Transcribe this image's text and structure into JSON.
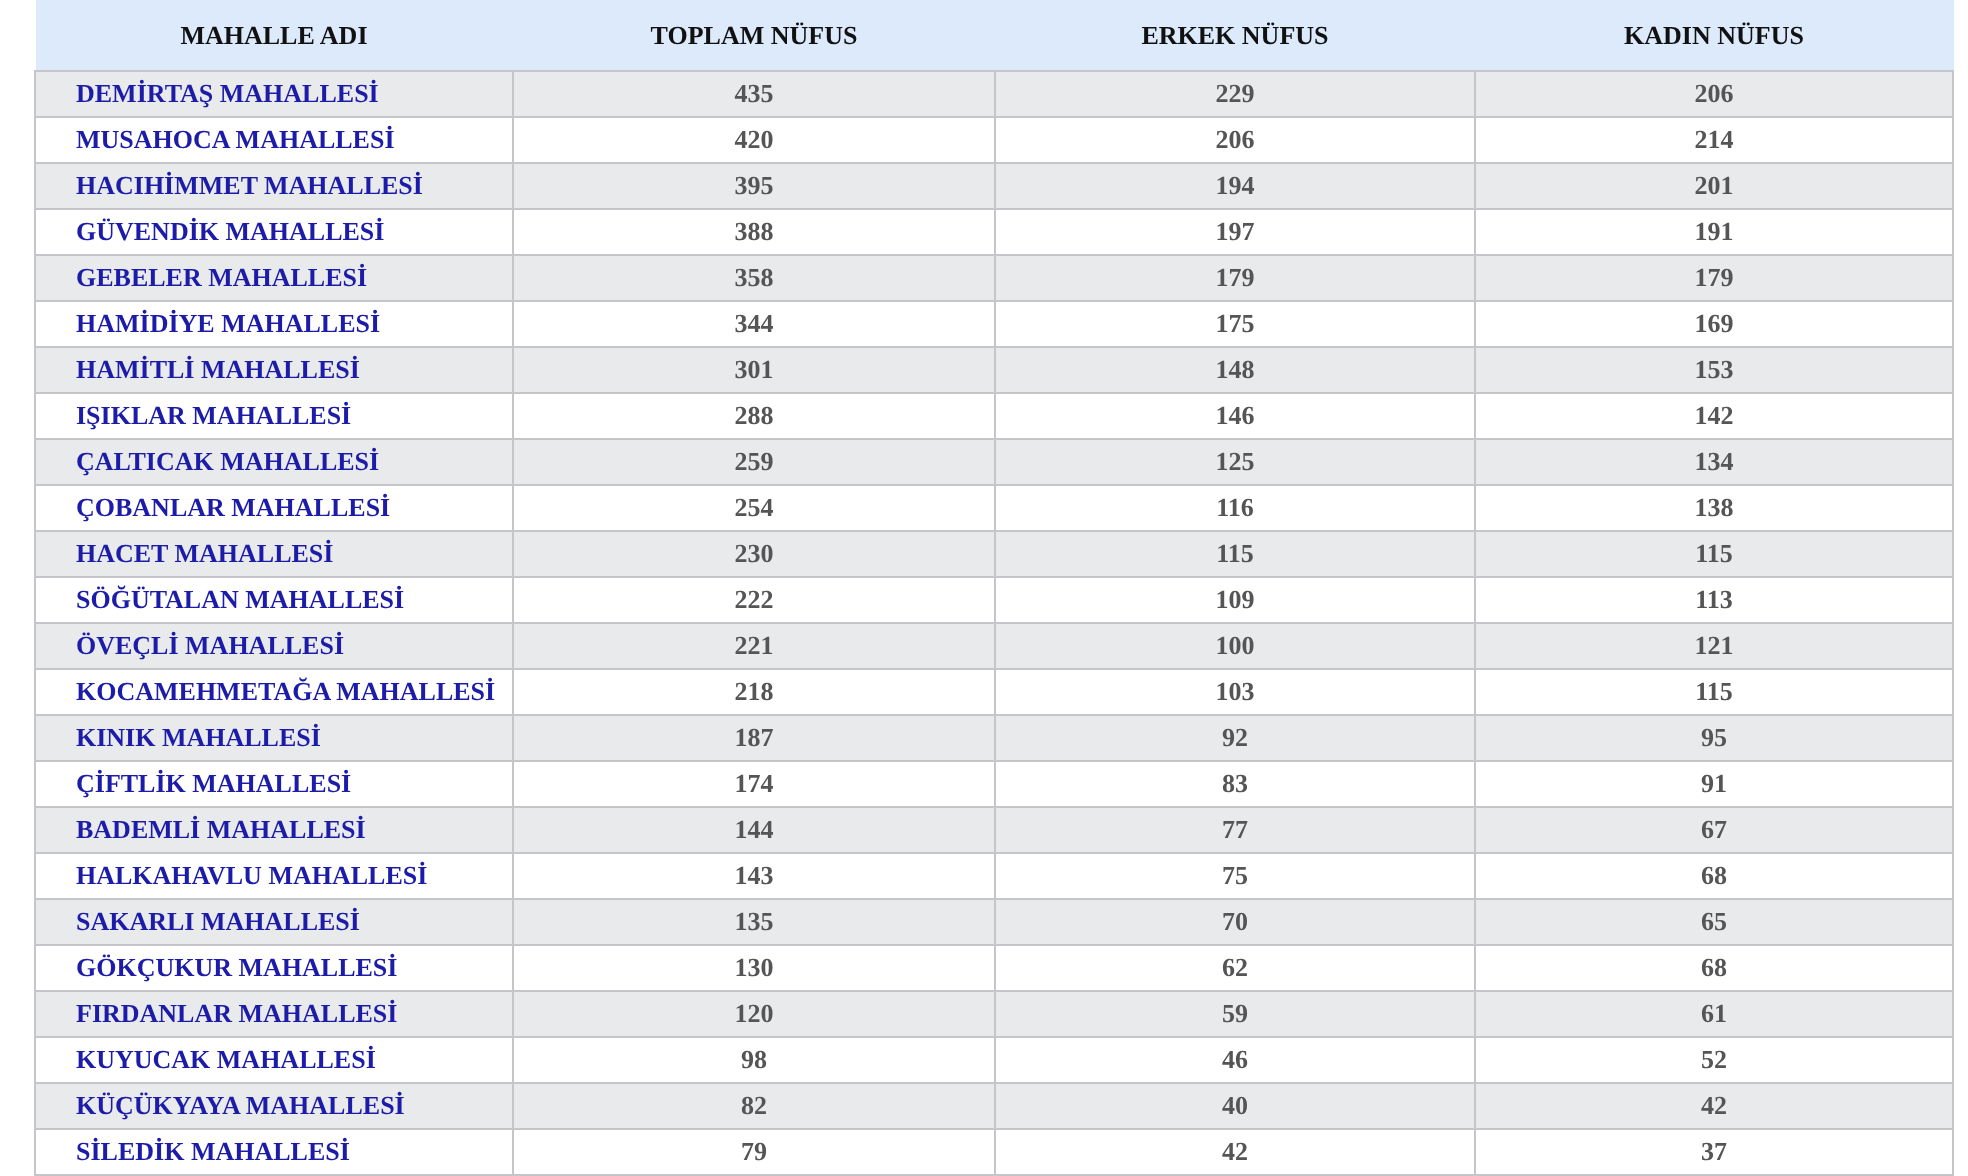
{
  "table": {
    "columns": [
      "MAHALLE ADI",
      "TOPLAM NÜFUS",
      "ERKEK NÜFUS",
      "KADIN NÜFUS"
    ],
    "rows": [
      [
        "DEMİRTAŞ MAHALLESİ",
        "435",
        "229",
        "206"
      ],
      [
        "MUSAHOCA MAHALLESİ",
        "420",
        "206",
        "214"
      ],
      [
        "HACIHİMMET MAHALLESİ",
        "395",
        "194",
        "201"
      ],
      [
        "GÜVENDİK MAHALLESİ",
        "388",
        "197",
        "191"
      ],
      [
        "GEBELER MAHALLESİ",
        "358",
        "179",
        "179"
      ],
      [
        "HAMİDİYE MAHALLESİ",
        "344",
        "175",
        "169"
      ],
      [
        "HAMİTLİ MAHALLESİ",
        "301",
        "148",
        "153"
      ],
      [
        "IŞIKLAR MAHALLESİ",
        "288",
        "146",
        "142"
      ],
      [
        "ÇALTICAK MAHALLESİ",
        "259",
        "125",
        "134"
      ],
      [
        "ÇOBANLAR MAHALLESİ",
        "254",
        "116",
        "138"
      ],
      [
        "HACET MAHALLESİ",
        "230",
        "115",
        "115"
      ],
      [
        "SÖĞÜTALAN MAHALLESİ",
        "222",
        "109",
        "113"
      ],
      [
        "ÖVEÇLİ MAHALLESİ",
        "221",
        "100",
        "121"
      ],
      [
        "KOCAMEHMETAĞA MAHALLESİ",
        "218",
        "103",
        "115"
      ],
      [
        "KINIK MAHALLESİ",
        "187",
        "92",
        "95"
      ],
      [
        "ÇİFTLİK MAHALLESİ",
        "174",
        "83",
        "91"
      ],
      [
        "BADEMLİ MAHALLESİ",
        "144",
        "77",
        "67"
      ],
      [
        "HALKAHAVLU MAHALLESİ",
        "143",
        "75",
        "68"
      ],
      [
        "SAKARLI MAHALLESİ",
        "135",
        "70",
        "65"
      ],
      [
        "GÖKÇUKUR MAHALLESİ",
        "130",
        "62",
        "68"
      ],
      [
        "FIRDANLAR MAHALLESİ",
        "120",
        "59",
        "61"
      ],
      [
        "KUYUCAK MAHALLESİ",
        "98",
        "46",
        "52"
      ],
      [
        "KÜÇÜKYAYA MAHALLESİ",
        "82",
        "40",
        "42"
      ],
      [
        "SİLEDİK MAHALLESİ",
        "79",
        "42",
        "37"
      ]
    ]
  }
}
